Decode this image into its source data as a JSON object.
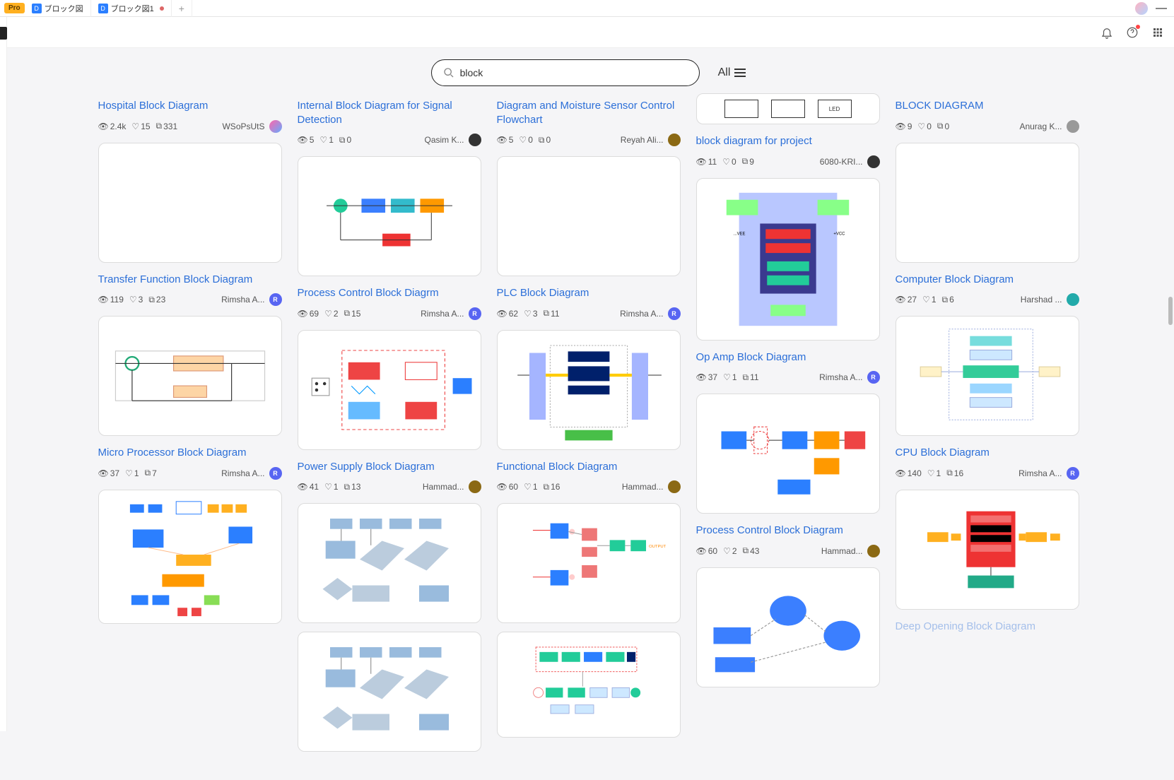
{
  "titlebar": {
    "pro": "Pro",
    "tab1": "ブロック図",
    "tab2": "ブロック図1"
  },
  "search": {
    "value": "block",
    "filter": "All"
  },
  "cols": [
    [
      {
        "title": "Hospital Block Diagram",
        "views": "2.4k",
        "likes": "15",
        "copies": "331",
        "author": "WSoPsUtS",
        "ava": "grad"
      },
      {
        "title": "Transfer Function Block Diagram",
        "views": "119",
        "likes": "3",
        "copies": "23",
        "author": "Rimsha A...",
        "ava": "r"
      },
      {
        "title": "Micro Processor Block Diagram",
        "views": "37",
        "likes": "1",
        "copies": "7",
        "author": "Rimsha A...",
        "ava": "r"
      }
    ],
    [
      {
        "title": "Internal Block Diagram for Signal Detection",
        "views": "5",
        "likes": "1",
        "copies": "0",
        "author": "Qasim K...",
        "ava": "dark"
      },
      {
        "title": "Process Control Block Diagrm",
        "views": "69",
        "likes": "2",
        "copies": "15",
        "author": "Rimsha A...",
        "ava": "r"
      },
      {
        "title": "Power Supply Block Diagram",
        "views": "41",
        "likes": "1",
        "copies": "13",
        "author": "Hammad...",
        "ava": "brown"
      }
    ],
    [
      {
        "title": "Diagram and Moisture Sensor Control Flowchart",
        "views": "5",
        "likes": "0",
        "copies": "0",
        "author": "Reyah Ali...",
        "ava": "brown",
        "partial_top": true
      },
      {
        "title": "PLC Block Diagram",
        "views": "62",
        "likes": "3",
        "copies": "11",
        "author": "Rimsha A...",
        "ava": "r"
      },
      {
        "title": "Functional Block Diagram",
        "views": "60",
        "likes": "1",
        "copies": "16",
        "author": "Hammad...",
        "ava": "brown"
      }
    ],
    [
      {
        "title": "block diagram for project",
        "views": "11",
        "likes": "0",
        "copies": "9",
        "author": "6080-KRI...",
        "ava": "dark",
        "partial_top_boxes": true
      },
      {
        "title": "Op Amp Block Diagram",
        "views": "37",
        "likes": "1",
        "copies": "11",
        "author": "Rimsha A...",
        "ava": "r"
      },
      {
        "title": "Process Control Block Diagram",
        "views": "60",
        "likes": "2",
        "copies": "43",
        "author": "Hammad...",
        "ava": "brown"
      }
    ],
    [
      {
        "title": "BLOCK DIAGRAM",
        "views": "9",
        "likes": "0",
        "copies": "0",
        "author": "Anurag K...",
        "ava": "gray",
        "no_top_thumb": true
      },
      {
        "title": "Computer Block Diagram",
        "views": "27",
        "likes": "1",
        "copies": "6",
        "author": "Harshad ...",
        "ava": "teal"
      },
      {
        "title": "CPU Block Diagram",
        "views": "140",
        "likes": "1",
        "copies": "16",
        "author": "Rimsha A...",
        "ava": "r"
      },
      {
        "title": "Deep Opening Block Diagram",
        "cut": true
      }
    ]
  ],
  "partial_boxes": [
    "",
    "",
    "LED"
  ]
}
